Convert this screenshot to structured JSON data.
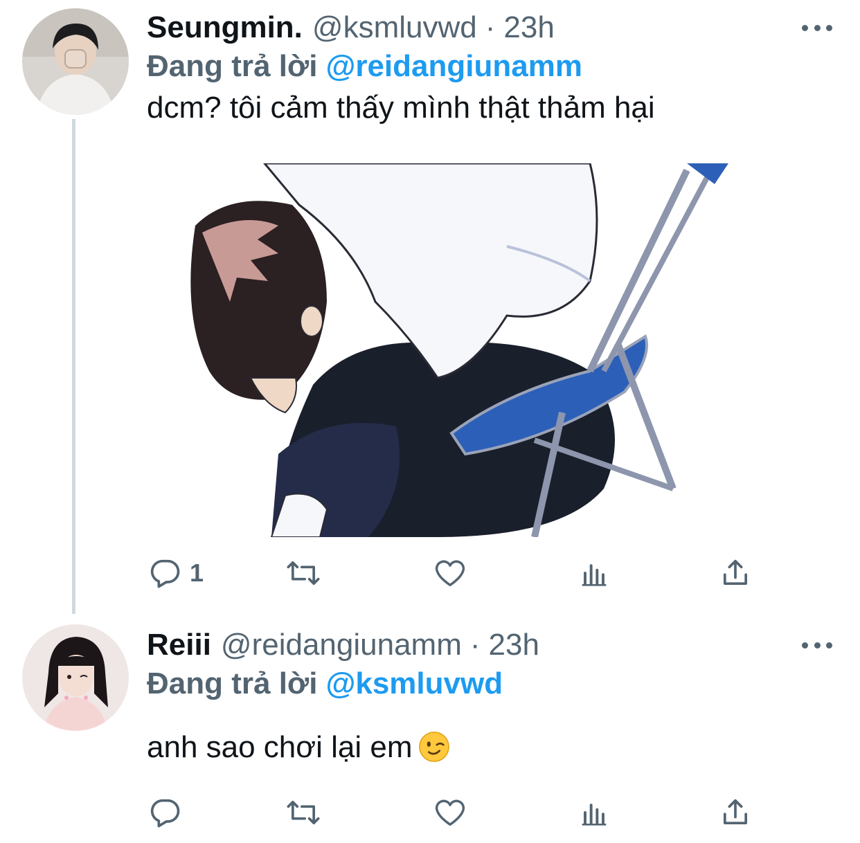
{
  "tweets": [
    {
      "name": "Seungmin.",
      "handle": "@ksmluvwd",
      "separator": "·",
      "time": "23h",
      "replying_label": "Đang trả lời",
      "replying_to": "@reidangiunamm",
      "text": "dcm? tôi cảm thấy mình thật thảm hại",
      "has_media": true,
      "actions": {
        "reply_count": "1",
        "retweet_count": "",
        "like_count": ""
      }
    },
    {
      "name": "Reiii",
      "handle": "@reidangiunamm",
      "separator": "·",
      "time": "23h",
      "replying_label": "Đang trả lời",
      "replying_to": "@ksmluvwd",
      "text": "anh sao chơi lại em",
      "emoji": "winking-face",
      "has_media": false,
      "actions": {
        "reply_count": "",
        "retweet_count": "",
        "like_count": ""
      }
    }
  ],
  "icons": {
    "reply": "reply-icon",
    "retweet": "retweet-icon",
    "like": "heart-icon",
    "views": "analytics-icon",
    "share": "share-icon",
    "more": "more-icon"
  },
  "colors": {
    "text": "#0f1419",
    "secondary": "#536471",
    "accent": "#1d9bf0",
    "thread_line": "#cfd9de"
  }
}
